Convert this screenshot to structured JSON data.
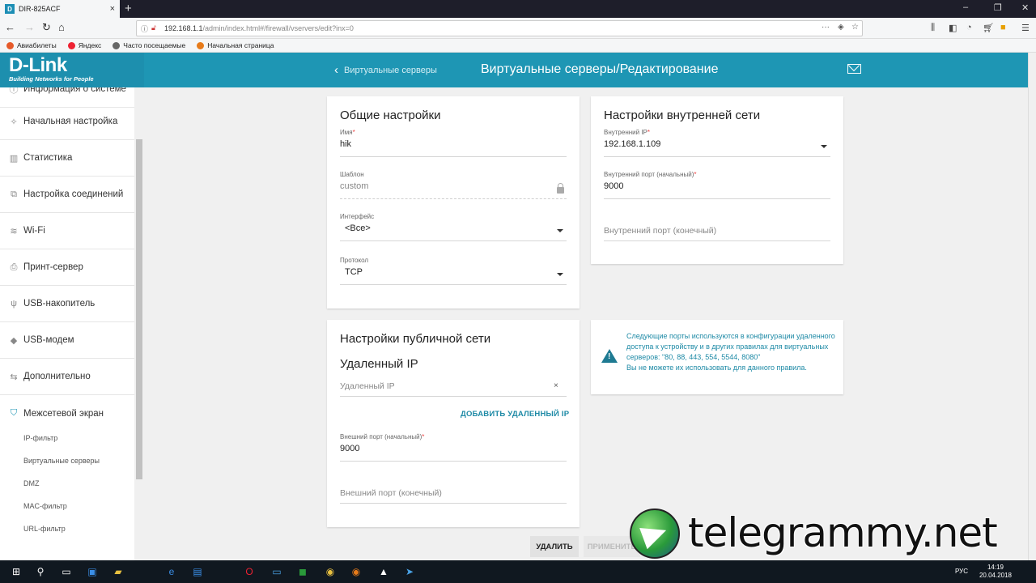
{
  "browser": {
    "tab_title": "DIR-825ACF",
    "tab_favicon": "D",
    "url_host": "192.168.1.1",
    "url_path": "/admin/index.html#/firewall/vservers/edit?inx=0",
    "bookmarks": [
      "Авиабилеты",
      "Яндекс",
      "Часто посещаемые",
      "Начальная страница"
    ]
  },
  "app": {
    "logo": "D-Link",
    "logo_tagline": "Building Networks for People",
    "back_label": "Виртуальные серверы",
    "page_title": "Виртуальные серверы/Редактирование",
    "accent": "#1e96b4"
  },
  "sidebar": {
    "items": [
      {
        "label": "Информация о системе",
        "icon": "info-icon"
      },
      {
        "label": "Начальная настройка",
        "icon": "wand-icon"
      },
      {
        "label": "Статистика",
        "icon": "chart-icon"
      },
      {
        "label": "Настройка соединений",
        "icon": "connection-icon"
      },
      {
        "label": "Wi-Fi",
        "icon": "wifi-icon"
      },
      {
        "label": "Принт-сервер",
        "icon": "printer-icon"
      },
      {
        "label": "USB-накопитель",
        "icon": "usb-icon"
      },
      {
        "label": "USB-модем",
        "icon": "modem-icon"
      },
      {
        "label": "Дополнительно",
        "icon": "sliders-icon"
      },
      {
        "label": "Межсетевой экран",
        "icon": "shield-icon"
      }
    ],
    "subitems": [
      "IP-фильтр",
      "Виртуальные серверы",
      "DMZ",
      "MAC-фильтр",
      "URL-фильтр"
    ]
  },
  "general": {
    "title": "Общие настройки",
    "name_label": "Имя",
    "name_value": "hik",
    "template_label": "Шаблон",
    "template_value": "custom",
    "interface_label": "Интерфейс",
    "interface_value": "<Все>",
    "protocol_label": "Протокол",
    "protocol_value": "TCP"
  },
  "internal": {
    "title": "Настройки внутренней сети",
    "ip_label": "Внутренний IP",
    "ip_value": "192.168.1.109",
    "port_start_label": "Внутренний порт (начальный)",
    "port_start_value": "9000",
    "port_end_placeholder": "Внутренний порт (конечный)"
  },
  "public": {
    "title": "Настройки публичной сети",
    "remote_title": "Удаленный IP",
    "remote_placeholder": "Удаленный IP",
    "clear_symbol": "×",
    "add_remote": "ДОБАВИТЬ УДАЛЕННЫЙ IP",
    "ext_port_start_label": "Внешний порт (начальный)",
    "ext_port_start_value": "9000",
    "ext_port_end_placeholder": "Внешний порт (конечный)"
  },
  "warning": {
    "text1": "Следующие порты используются в конфигурации удаленного доступа к устройству и в других правилах для виртуальных серверов: \"80, 88, 443, 554, 5544, 8080\"",
    "text2": "Вы не можете их использовать для данного правила."
  },
  "actions": {
    "delete": "УДАЛИТЬ",
    "apply": "ПРИМЕНИТЬ"
  },
  "watermark": "telegrammy.net",
  "taskbar": {
    "lang": "РУС",
    "time": "14:19",
    "date": "20.04.2018"
  }
}
